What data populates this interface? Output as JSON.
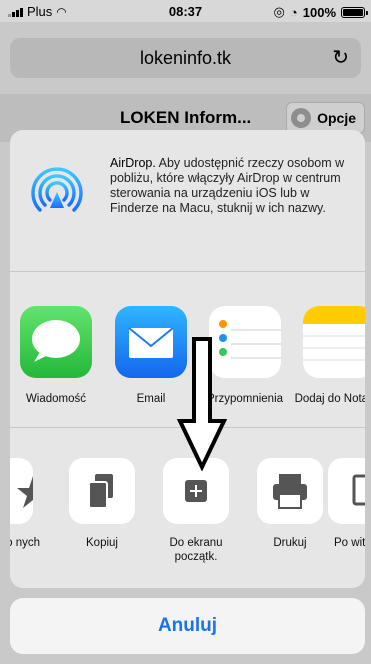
{
  "status": {
    "carrier": "Plus",
    "time": "08:37",
    "battery": "100%"
  },
  "browser": {
    "url": "lokeninfo.tk",
    "reload_icon": "reload-icon"
  },
  "page": {
    "title": "LOKEN Inform...",
    "options_label": "Opcje"
  },
  "share_sheet": {
    "airdrop": {
      "title": "AirDrop.",
      "text": "Aby udostępnić rzeczy osobom w pobliżu, które włączyły AirDrop w centrum sterowania na urządzeniu iOS lub w Finderze na Macu, stuknij w ich nazwy."
    },
    "apps": [
      {
        "label": "Wiadomość",
        "icon": "messages-icon"
      },
      {
        "label": "Email",
        "icon": "mail-icon"
      },
      {
        "label": "Przypomnienia",
        "icon": "reminders-icon"
      },
      {
        "label": "Dodaj do Notatek",
        "icon": "notes-icon"
      }
    ],
    "actions": [
      {
        "label": "j do nych",
        "icon": "star-icon"
      },
      {
        "label": "Kopiuj",
        "icon": "copy-icon"
      },
      {
        "label": "Do ekranu początk.",
        "icon": "add-to-home-icon"
      },
      {
        "label": "Drukuj",
        "icon": "print-icon"
      },
      {
        "label": "Po witry",
        "icon": "find-icon"
      }
    ],
    "cancel_label": "Anuluj"
  },
  "colors": {
    "accent": "#1a73e8",
    "messages": "#34c759",
    "mail": "#1e90ff",
    "notes": "#ffcc00"
  }
}
